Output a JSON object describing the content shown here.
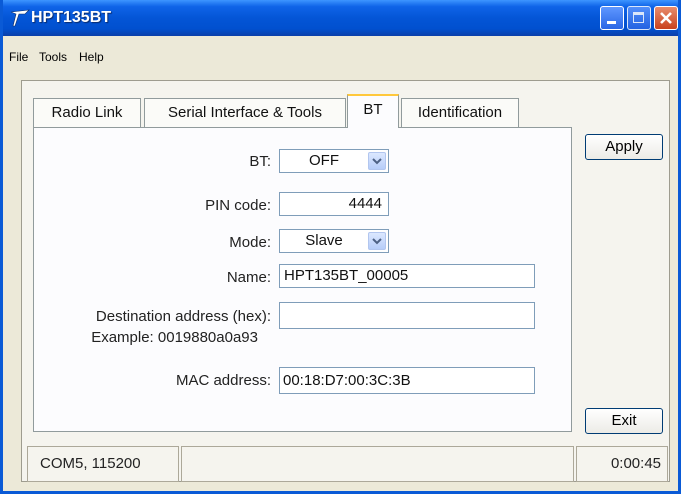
{
  "window": {
    "title": "HPT135BT"
  },
  "menu": {
    "items": [
      "File",
      "Tools",
      "Help"
    ]
  },
  "tabs": [
    {
      "label": "Radio Link"
    },
    {
      "label": "Serial Interface & Tools"
    },
    {
      "label": "BT"
    },
    {
      "label": "Identification"
    }
  ],
  "active_tab": "BT",
  "form": {
    "bt": {
      "label": "BT:",
      "value": "OFF"
    },
    "pin": {
      "label": "PIN code:",
      "value": "4444"
    },
    "mode": {
      "label": "Mode:",
      "value": "Slave"
    },
    "name": {
      "label": "Name:",
      "value": "HPT135BT_00005"
    },
    "dest": {
      "label": "Destination address (hex):",
      "example": "Example: 0019880a0a93",
      "value": ""
    },
    "mac": {
      "label": "MAC address:",
      "value": "00:18:D7:00:3C:3B"
    }
  },
  "buttons": {
    "apply": "Apply",
    "exit": "Exit"
  },
  "status": {
    "port": "COM5, 115200",
    "middle": "",
    "time": "0:00:45"
  },
  "colors": {
    "titlebar": "#0455d6",
    "active_tab_accent": "#ffc83c",
    "face": "#ece9d8"
  }
}
